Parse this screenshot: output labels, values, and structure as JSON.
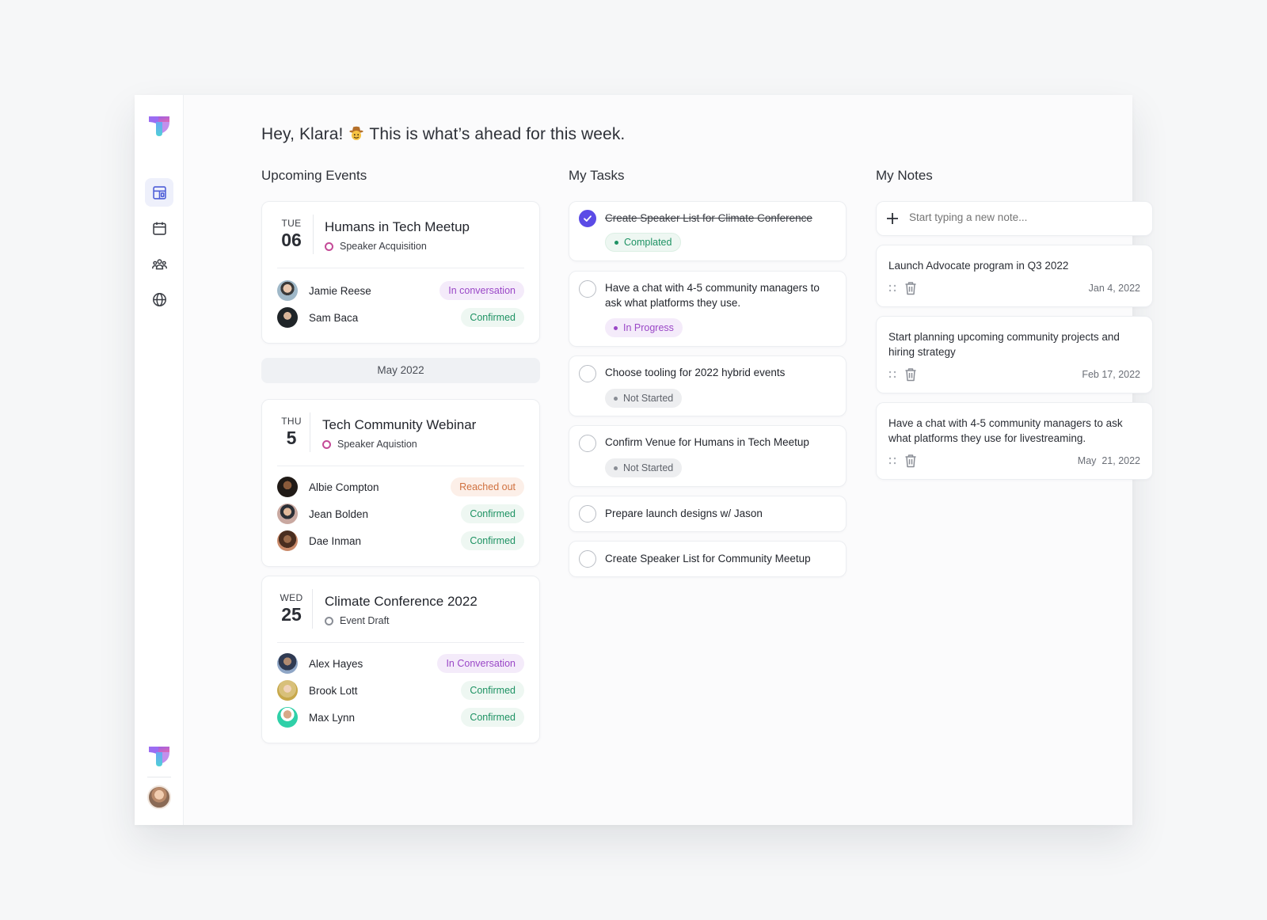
{
  "greeting": {
    "prefix": "Hey, Klara!",
    "emoji": "cowboy-face",
    "suffix": "This is what’s ahead for this week."
  },
  "columns": {
    "events": "Upcoming Events",
    "tasks": "My Tasks",
    "notes": "My Notes"
  },
  "sidebar": {
    "items": [
      "dashboard-icon",
      "calendar-icon",
      "community-icon",
      "globe-icon"
    ],
    "active": "dashboard-icon"
  },
  "colors": {
    "accent": "#5b4be6",
    "confirmed": "#1e9263",
    "in_conversation": "#9a47c7",
    "reached_out": "#d0713f"
  },
  "events": [
    {
      "dow": "TUE",
      "day": "06",
      "title": "Humans in Tech Meetup",
      "tag": "Speaker Acquisition",
      "tag_color": "pink",
      "attendees": [
        {
          "name": "Jamie Reese",
          "status": "In conversation",
          "variant": "purple"
        },
        {
          "name": "Sam Baca",
          "status": "Confirmed",
          "variant": "green"
        }
      ]
    },
    {
      "dow": "THU",
      "day": "5",
      "title": "Tech Community Webinar",
      "tag": "Speaker Aquistion",
      "tag_color": "pink",
      "attendees": [
        {
          "name": "Albie Compton",
          "status": "Reached out",
          "variant": "orange"
        },
        {
          "name": "Jean Bolden",
          "status": "Confirmed",
          "variant": "green"
        },
        {
          "name": "Dae Inman",
          "status": "Confirmed",
          "variant": "green"
        }
      ]
    },
    {
      "dow": "WED",
      "day": "25",
      "title": "Climate Conference 2022",
      "tag": "Event Draft",
      "tag_color": "grey",
      "attendees": [
        {
          "name": "Alex Hayes",
          "status": "In Conversation",
          "variant": "purple"
        },
        {
          "name": "Brook Lott",
          "status": "Confirmed",
          "variant": "green"
        },
        {
          "name": "Max Lynn",
          "status": "Confirmed",
          "variant": "green"
        }
      ]
    }
  ],
  "month_divider": "May 2022",
  "tasks": [
    {
      "text": "Create Speaker List for Climate Conference",
      "done": true,
      "status": "Complated",
      "variant": "green"
    },
    {
      "text": "Have a chat with 4-5 community managers to ask what platforms they use.",
      "done": false,
      "status": "In Progress",
      "variant": "purple"
    },
    {
      "text": "Choose tooling for 2022 hybrid events",
      "done": false,
      "status": "Not Started",
      "variant": "grey"
    },
    {
      "text": "Confirm Venue for Humans in Tech Meetup",
      "done": false,
      "status": "Not Started",
      "variant": "grey"
    },
    {
      "text": "Prepare launch designs w/ Jason",
      "done": false
    },
    {
      "text": "Create Speaker List for Community Meetup",
      "done": false
    }
  ],
  "notes": {
    "placeholder": "Start typing a new note...",
    "items": [
      {
        "text": "Launch Advocate program in Q3 2022",
        "date": "Jan 4, 2022"
      },
      {
        "text": "Start planning upcoming community projects and hiring strategy",
        "date": "Feb 17, 2022"
      },
      {
        "text": "Have a chat with 4-5 community managers to ask what platforms they use for livestreaming.",
        "date": "May  21, 2022"
      }
    ]
  }
}
